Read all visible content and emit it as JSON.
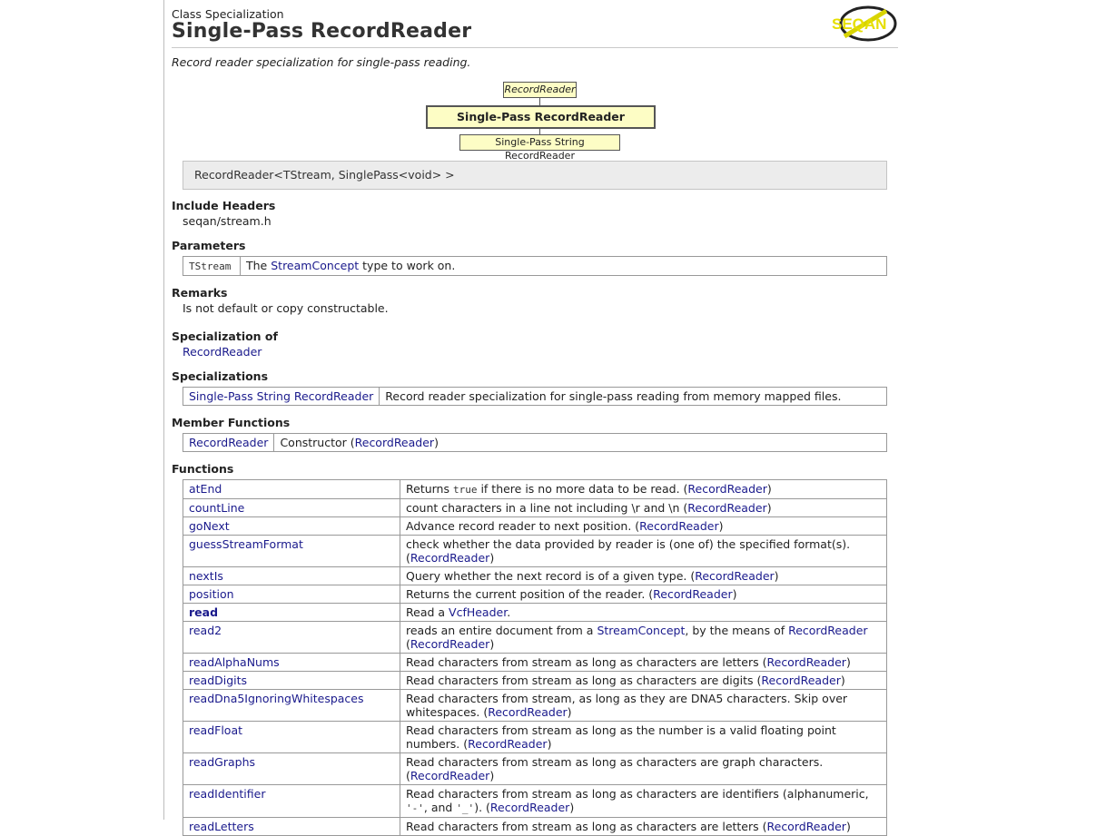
{
  "header": {
    "kind": "Class Specialization",
    "title": "Single-Pass RecordReader",
    "brief": "Record reader specialization for single-pass reading.",
    "logo_text": "SEQAN"
  },
  "diagram": {
    "parent": "RecordReader",
    "current": "Single-Pass RecordReader",
    "child": "Single-Pass String RecordReader"
  },
  "signature": "RecordReader<TStream, SinglePass<void> >",
  "include_headers": {
    "heading": "Include Headers",
    "value": "seqan/stream.h"
  },
  "parameters": {
    "heading": "Parameters",
    "rows": [
      {
        "name": "TStream",
        "pre": "The ",
        "link": "StreamConcept",
        "post": " type to work on."
      }
    ]
  },
  "remarks": {
    "heading": "Remarks",
    "value": "Is not default or copy constructable."
  },
  "specialization_of": {
    "heading": "Specialization of",
    "link": "RecordReader"
  },
  "specializations": {
    "heading": "Specializations",
    "rows": [
      {
        "name": "Single-Pass String RecordReader",
        "desc": "Record reader specialization for single-pass reading from memory mapped files."
      }
    ]
  },
  "member_functions": {
    "heading": "Member Functions",
    "rows": [
      {
        "name": "RecordReader",
        "pre": "Constructor (",
        "link": "RecordReader",
        "post": ")"
      }
    ]
  },
  "functions": {
    "heading": "Functions",
    "rows": [
      {
        "name": "atEnd",
        "bold": false,
        "parts": [
          {
            "t": "Returns "
          },
          {
            "code": "true"
          },
          {
            "t": " if there is no more data to be read. ("
          },
          {
            "link": "RecordReader"
          },
          {
            "t": ")"
          }
        ]
      },
      {
        "name": "countLine",
        "bold": false,
        "parts": [
          {
            "t": "count characters in a line not including \\r and \\n ("
          },
          {
            "link": "RecordReader"
          },
          {
            "t": ")"
          }
        ]
      },
      {
        "name": "goNext",
        "bold": false,
        "parts": [
          {
            "t": "Advance record reader to next position. ("
          },
          {
            "link": "RecordReader"
          },
          {
            "t": ")"
          }
        ]
      },
      {
        "name": "guessStreamFormat",
        "bold": false,
        "parts": [
          {
            "t": "check whether the data provided by reader is (one of) the specified format(s). ("
          },
          {
            "link": "RecordReader"
          },
          {
            "t": ")"
          }
        ]
      },
      {
        "name": "nextIs",
        "bold": false,
        "parts": [
          {
            "t": "Query whether the next record is of a given type. ("
          },
          {
            "link": "RecordReader"
          },
          {
            "t": ")"
          }
        ]
      },
      {
        "name": "position",
        "bold": false,
        "parts": [
          {
            "t": "Returns the current position of the reader. ("
          },
          {
            "link": "RecordReader"
          },
          {
            "t": ")"
          }
        ]
      },
      {
        "name": "read",
        "bold": true,
        "parts": [
          {
            "t": "Read a "
          },
          {
            "link": "VcfHeader"
          },
          {
            "t": "."
          }
        ]
      },
      {
        "name": "read2",
        "bold": false,
        "parts": [
          {
            "t": "reads an entire document from a "
          },
          {
            "link": "StreamConcept"
          },
          {
            "t": ", by the means of "
          },
          {
            "link": "RecordReader"
          },
          {
            "t": " ("
          },
          {
            "link": "RecordReader"
          },
          {
            "t": ")"
          }
        ]
      },
      {
        "name": "readAlphaNums",
        "bold": false,
        "parts": [
          {
            "t": "Read characters from stream as long as characters are letters ("
          },
          {
            "link": "RecordReader"
          },
          {
            "t": ")"
          }
        ]
      },
      {
        "name": "readDigits",
        "bold": false,
        "parts": [
          {
            "t": "Read characters from stream as long as characters are digits ("
          },
          {
            "link": "RecordReader"
          },
          {
            "t": ")"
          }
        ]
      },
      {
        "name": "readDna5IgnoringWhitespaces",
        "bold": false,
        "parts": [
          {
            "t": "Read characters from stream, as long as they are DNA5 characters. Skip over whitespaces. ("
          },
          {
            "link": "RecordReader"
          },
          {
            "t": ")"
          }
        ]
      },
      {
        "name": "readFloat",
        "bold": false,
        "parts": [
          {
            "t": "Read characters from stream as long as the number is a valid floating point numbers. ("
          },
          {
            "link": "RecordReader"
          },
          {
            "t": ")"
          }
        ]
      },
      {
        "name": "readGraphs",
        "bold": false,
        "parts": [
          {
            "t": "Read characters from stream as long as characters are graph characters. ("
          },
          {
            "link": "RecordReader"
          },
          {
            "t": ")"
          }
        ]
      },
      {
        "name": "readIdentifier",
        "bold": false,
        "parts": [
          {
            "t": "Read characters from stream as long as characters are identifiers (alphanumeric, "
          },
          {
            "code": "'-'"
          },
          {
            "t": ", and "
          },
          {
            "code": "'_'"
          },
          {
            "t": "). ("
          },
          {
            "link": "RecordReader"
          },
          {
            "t": ")"
          }
        ]
      },
      {
        "name": "readLetters",
        "bold": false,
        "parts": [
          {
            "t": "Read characters from stream as long as characters are letters ("
          },
          {
            "link": "RecordReader"
          },
          {
            "t": ")"
          }
        ]
      }
    ]
  },
  "colors": {
    "link": "#1a1a8c",
    "diagram_fill": "#fdfdc5",
    "code_bg": "#ececec"
  }
}
